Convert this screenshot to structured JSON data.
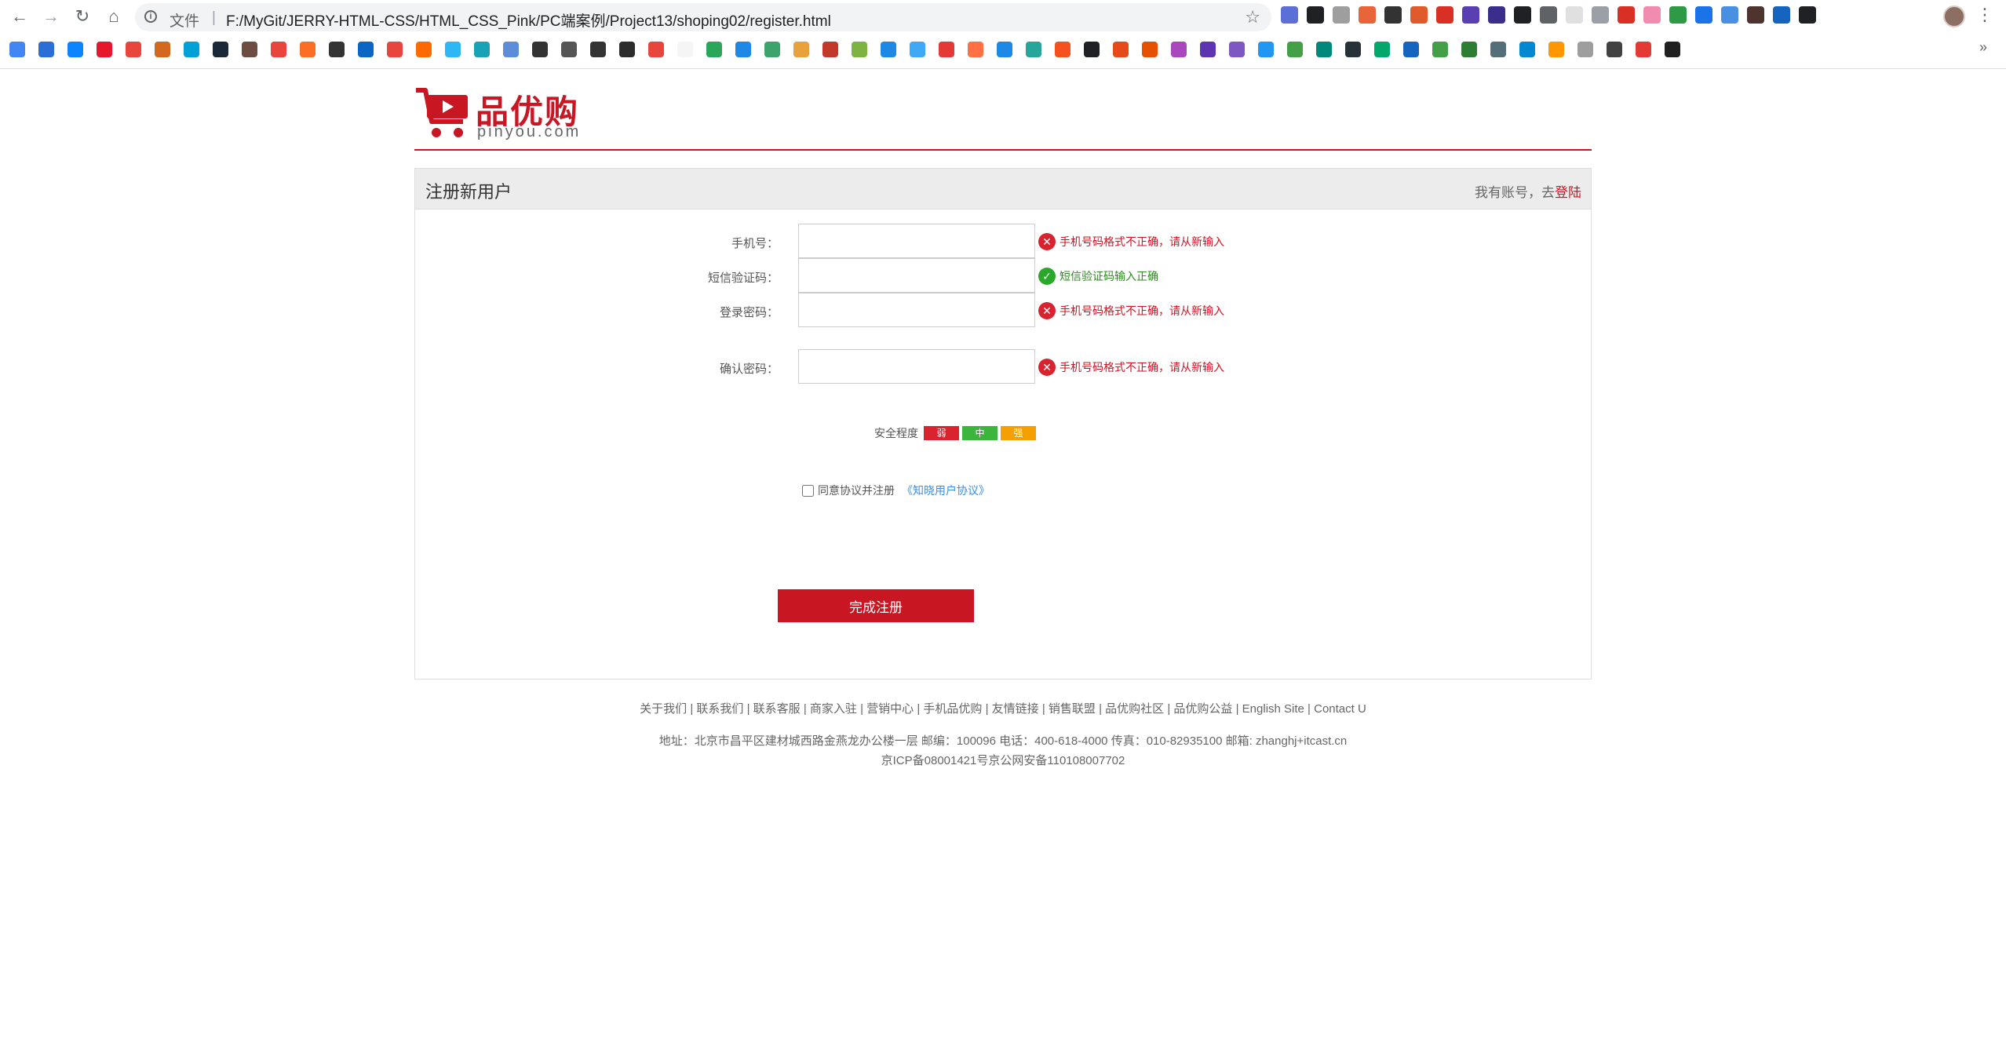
{
  "browser": {
    "file_label": "文件",
    "url": "F:/MyGit/JERRY-HTML-CSS/HTML_CSS_Pink/PC端案例/Project13/shoping02/register.html",
    "extension_colors": [
      "#5b6fd6",
      "#202124",
      "#9e9e9e",
      "#e8653a",
      "#333333",
      "#e05a2b",
      "#d93025",
      "#5a3fb3",
      "#3a2e8c",
      "#202124",
      "#5f6368",
      "#e0e0e0",
      "#9aa0a6",
      "#d93025",
      "#f28bb0",
      "#2e9a45",
      "#1a73e8",
      "#4a90e2",
      "#4e342e",
      "#1565c0",
      "#202124"
    ],
    "bookmark_colors": [
      "#4285f4",
      "#2b6fd6",
      "#0a84ff",
      "#e6162d",
      "#e8453c",
      "#d2691e",
      "#00a1d6",
      "#1b2838",
      "#6d4c41",
      "#e8453c",
      "#fc6d26",
      "#333333",
      "#0a66c2",
      "#e8453c",
      "#ff6a00",
      "#2db7f5",
      "#17a2b8",
      "#5b8dd9",
      "#333333",
      "#555555",
      "#333333",
      "#2c2c2c",
      "#e8453c",
      "#f5f5f5",
      "#2aa65b",
      "#1e88e5",
      "#3ca36b",
      "#e8a13c",
      "#c0392b",
      "#7cb342",
      "#1e88e5",
      "#3fa9f5",
      "#e53935",
      "#ff7043",
      "#1e88e5",
      "#26a69a",
      "#f4511e",
      "#202124",
      "#e64a19",
      "#e65100",
      "#ab47bc",
      "#5e35b1",
      "#7e57c2",
      "#2196f3",
      "#43a047",
      "#00897b",
      "#263238",
      "#00a86b",
      "#1565c0",
      "#43a047",
      "#2e7d32",
      "#546e7a",
      "#0288d1",
      "#ff9800",
      "#9e9e9e",
      "#424242",
      "#e53935",
      "#212121"
    ]
  },
  "logo": {
    "cn": "品优购",
    "en": "pinyou.com"
  },
  "panel": {
    "title": "注册新用户",
    "login_prompt": "我有账号，去",
    "login_link": "登陆"
  },
  "form": {
    "phone": {
      "label": "手机号：",
      "value": "",
      "message": "手机号码格式不正确，请从新输入",
      "status": "error"
    },
    "sms": {
      "label": "短信验证码：",
      "value": "",
      "message": "短信验证码输入正确",
      "status": "ok"
    },
    "password": {
      "label": "登录密码：",
      "value": "",
      "message": "手机号码格式不正确，请从新输入",
      "status": "error"
    },
    "strength": {
      "label": "安全程度",
      "weak": "弱",
      "medium": "中",
      "strong": "强"
    },
    "confirm": {
      "label": "确认密码：",
      "value": "",
      "message": "手机号码格式不正确，请从新输入",
      "status": "error"
    },
    "agree": {
      "text": "同意协议并注册",
      "link": "《知晓用户协议》",
      "checked": false
    },
    "submit": "完成注册"
  },
  "footer": {
    "links": [
      "关于我们",
      "联系我们",
      "联系客服",
      "商家入驻",
      "营销中心",
      "手机品优购",
      "友情链接",
      "销售联盟",
      "品优购社区",
      "品优购公益",
      "English Site",
      "Contact U"
    ],
    "address": "地址：北京市昌平区建材城西路金燕龙办公楼一层 邮编：100096 电话：400-618-4000 传真：010-82935100 邮箱: zhanghj+itcast.cn",
    "icp": "京ICP备08001421号京公网安备110108007702"
  }
}
